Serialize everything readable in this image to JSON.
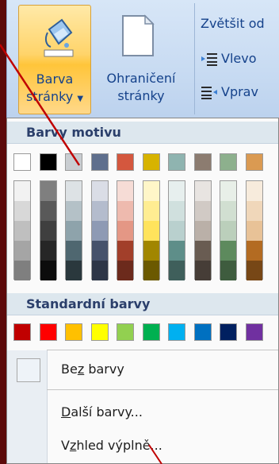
{
  "ribbon": {
    "barva_label_1": "Barva",
    "barva_label_2": "stránky",
    "ohraniceni_label_1": "Ohraničení",
    "ohraniceni_label_2": "stránky",
    "zvetsit_label": "Zvětšit od",
    "vlevo_label": "Vlevo",
    "vpravo_label": "Vprav"
  },
  "dropdown": {
    "theme_header": "Barvy motivu",
    "standard_header": "Standardní barvy",
    "theme_colors": [
      "#ffffff",
      "#000000",
      "#c9cdd1",
      "#5f6f8d",
      "#d4573e",
      "#d7b300",
      "#8fb4b0",
      "#8c7c70",
      "#8db08d",
      "#da9a52"
    ],
    "theme_shades": [
      [
        "#f2f2f2",
        "#d8d8d8",
        "#bfbfbf",
        "#a5a5a5",
        "#7f7f7f"
      ],
      [
        "#7f7f7f",
        "#595959",
        "#3f3f3f",
        "#262626",
        "#0c0c0c"
      ],
      [
        "#dde2e5",
        "#b4c1c7",
        "#8ea3ab",
        "#4f6770",
        "#2a383d"
      ],
      [
        "#dadde6",
        "#b4bccd",
        "#8e9ab4",
        "#46526b",
        "#2e3647"
      ],
      [
        "#f6dcd6",
        "#eebaae",
        "#e49785",
        "#a23f2a",
        "#6c2a1c"
      ],
      [
        "#fff6c8",
        "#ffed92",
        "#ffe35c",
        "#a18600",
        "#6b5900"
      ],
      [
        "#e7efee",
        "#d0e0de",
        "#b9d0ce",
        "#5e8e89",
        "#3f5f5b"
      ],
      [
        "#e8e4e1",
        "#d1cac5",
        "#bab0a8",
        "#695c52",
        "#463d37"
      ],
      [
        "#e8efe8",
        "#d1dfd1",
        "#bbcfbb",
        "#5d8a5d",
        "#3e5c3e"
      ],
      [
        "#f7ebdc",
        "#f0d7ba",
        "#e8c297",
        "#b36b22",
        "#774716"
      ]
    ],
    "standard_colors": [
      "#c00000",
      "#ff0000",
      "#ffc000",
      "#ffff00",
      "#92d050",
      "#00b050",
      "#00b0f0",
      "#0070c0",
      "#002060",
      "#7030a0"
    ],
    "no_color_prefix": "Be",
    "no_color_accel": "z",
    "no_color_suffix": " barvy",
    "more_colors_accel": "D",
    "more_colors_suffix": "alší barvy...",
    "fill_prefix": "V",
    "fill_accel": "z",
    "fill_suffix": "hled výplně..."
  }
}
